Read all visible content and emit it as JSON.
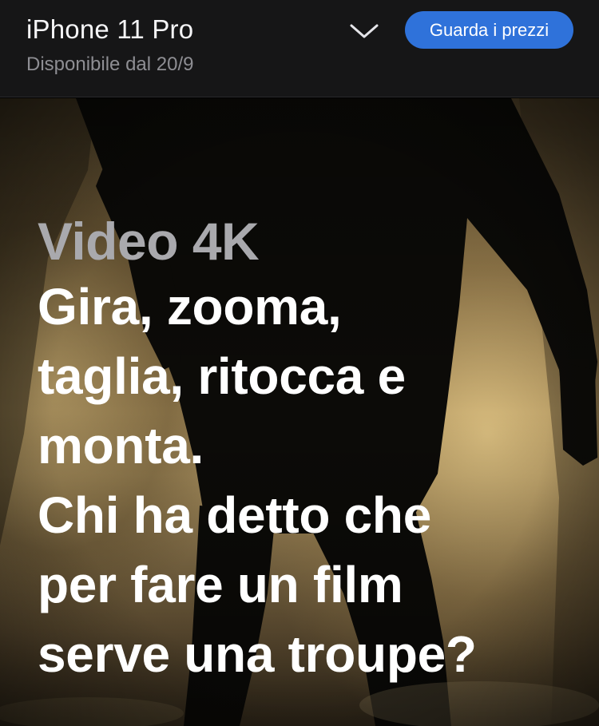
{
  "product_bar": {
    "product_name": "iPhone 11 Pro",
    "availability": "Disponibile dal 20/9",
    "cta_label": "Guarda i prezzi",
    "chevron_icon": "chevron-down-icon",
    "colors": {
      "bar_background": "#161617",
      "cta_background": "#2f72da",
      "cta_text": "#ffffff"
    }
  },
  "hero": {
    "eyebrow": "Video 4K",
    "headline_lines": [
      "Gira, zooma,",
      "taglia, ritocca e",
      "monta.",
      "Chi ha detto che",
      "per fare un film",
      "serve una troupe?"
    ],
    "image": "silhouette of a man walking in a foggy street",
    "colors": {
      "eyebrow": "#a9a9ad",
      "headline": "#ffffff"
    }
  }
}
